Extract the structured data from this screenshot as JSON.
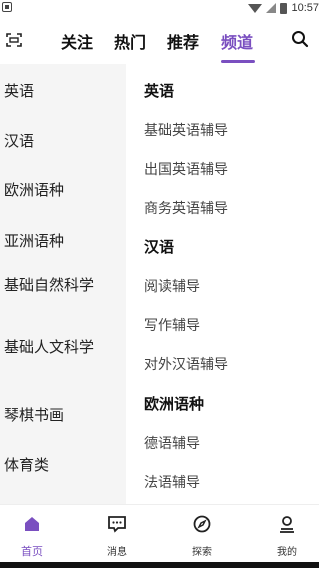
{
  "status_bar": {
    "time": "10:57"
  },
  "top_nav": {
    "tabs": [
      {
        "label": "关注"
      },
      {
        "label": "热门"
      },
      {
        "label": "推荐"
      },
      {
        "label": "频道"
      }
    ],
    "active_tab": "频道",
    "accent_color": "#7a4fc0"
  },
  "categories": [
    {
      "label": "英语"
    },
    {
      "label": "汉语"
    },
    {
      "label": "欧洲语种"
    },
    {
      "label": "亚洲语种"
    },
    {
      "label": "基础自然科学"
    },
    {
      "label": "基础人文科学"
    },
    {
      "label": "琴棋书画"
    },
    {
      "label": "体育类"
    }
  ],
  "content": {
    "sections": [
      {
        "title": "英语",
        "items": [
          "基础英语辅导",
          "出国英语辅导",
          "商务英语辅导"
        ]
      },
      {
        "title": "汉语",
        "items": [
          "阅读辅导",
          "写作辅导",
          "对外汉语辅导"
        ]
      },
      {
        "title": "欧洲语种",
        "items": [
          "德语辅导",
          "法语辅导"
        ]
      }
    ]
  },
  "bottom_nav": {
    "items": [
      {
        "label": "首页",
        "icon": "home-icon"
      },
      {
        "label": "消息",
        "icon": "message-icon"
      },
      {
        "label": "探索",
        "icon": "compass-icon"
      },
      {
        "label": "我的",
        "icon": "profile-icon"
      }
    ],
    "active": "首页"
  }
}
